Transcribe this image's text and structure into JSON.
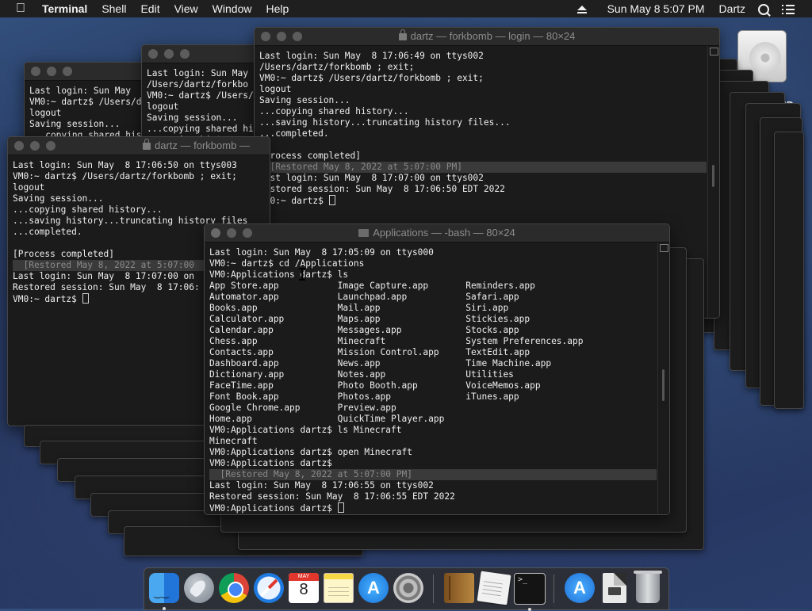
{
  "menubar": {
    "apple": "",
    "app_name": "Terminal",
    "menus": [
      "Shell",
      "Edit",
      "View",
      "Window",
      "Help"
    ],
    "clock": "Sun May  8  5:07 PM",
    "user": "Dartz"
  },
  "desktop": {
    "drive_label": "ID"
  },
  "windows": {
    "back_left": {
      "lines": "Last login: Sun May\nVM0:~ dartz$ /Users/d\nlogout\nSaving session...\n...copying shared his"
    },
    "back_mid": {
      "lines": "Last login: Sun May\n/Users/dartz/forkbo\nVM0:~ dartz$ /Users/\nlogout\nSaving session...\n...copying shared hi\n...saving history..."
    },
    "login": {
      "title": "dartz — forkbomb — login — 80×24",
      "pre": "Last login: Sun May  8 17:06:49 on ttys002\n/Users/dartz/forkbomb ; exit;\nVM0:~ dartz$ /Users/dartz/forkbomb ; exit;\nlogout\nSaving session...\n...copying shared history...\n...saving history...truncating history files...\n...completed.\n\n[Process completed]",
      "restored": "  [Restored May 8, 2022 at 5:07:00 PM]",
      "post": "Last login: Sun May  8 17:07:00 on ttys002\nRestored session: Sun May  8 17:06:50 EDT 2022\nVM0:~ dartz$ "
    },
    "forkbomb_left": {
      "title": "dartz — forkbomb —",
      "pre": "Last login: Sun May  8 17:06:50 on ttys003\nVM0:~ dartz$ /Users/dartz/forkbomb ; exit;\nlogout\nSaving session...\n...copying shared history...\n...saving history...truncating history files\n...completed.\n\n[Process completed]",
      "restored": "  [Restored May 8, 2022 at 5:07:00",
      "post": "Last login: Sun May  8 17:07:00 on\nRestored session: Sun May  8 17:06:\nVM0:~ dartz$ "
    },
    "apps": {
      "title": "Applications — -bash — 80×24",
      "pre": "Last login: Sun May  8 17:05:09 on ttys000\nVM0:~ dartz$ cd /Applications\nVM0:Applications dartz$ ls\nApp Store.app           Image Capture.app       Reminders.app\nAutomator.app           Launchpad.app           Safari.app\nBooks.app               Mail.app                Siri.app\nCalculator.app          Maps.app                Stickies.app\nCalendar.app            Messages.app            Stocks.app\nChess.app               Minecraft               System Preferences.app\nContacts.app            Mission Control.app     TextEdit.app\nDashboard.app           News.app                Time Machine.app\nDictionary.app          Notes.app               Utilities\nFaceTime.app            Photo Booth.app         VoiceMemos.app\nFont Book.app           Photos.app              iTunes.app\nGoogle Chrome.app       Preview.app\nHome.app                QuickTime Player.app\nVM0:Applications dartz$ ls Minecraft\nMinecraft\nVM0:Applications dartz$ open Minecraft\nVM0:Applications dartz$",
      "restored": "  [Restored May 8, 2022 at 5:07:00 PM]",
      "post": "Last login: Sun May  8 17:06:55 on ttys002\nRestored session: Sun May  8 17:06:55 EDT 2022\nVM0:Applications dartz$ "
    }
  },
  "dock": {
    "calendar_month": "MAY",
    "calendar_day": "8"
  }
}
